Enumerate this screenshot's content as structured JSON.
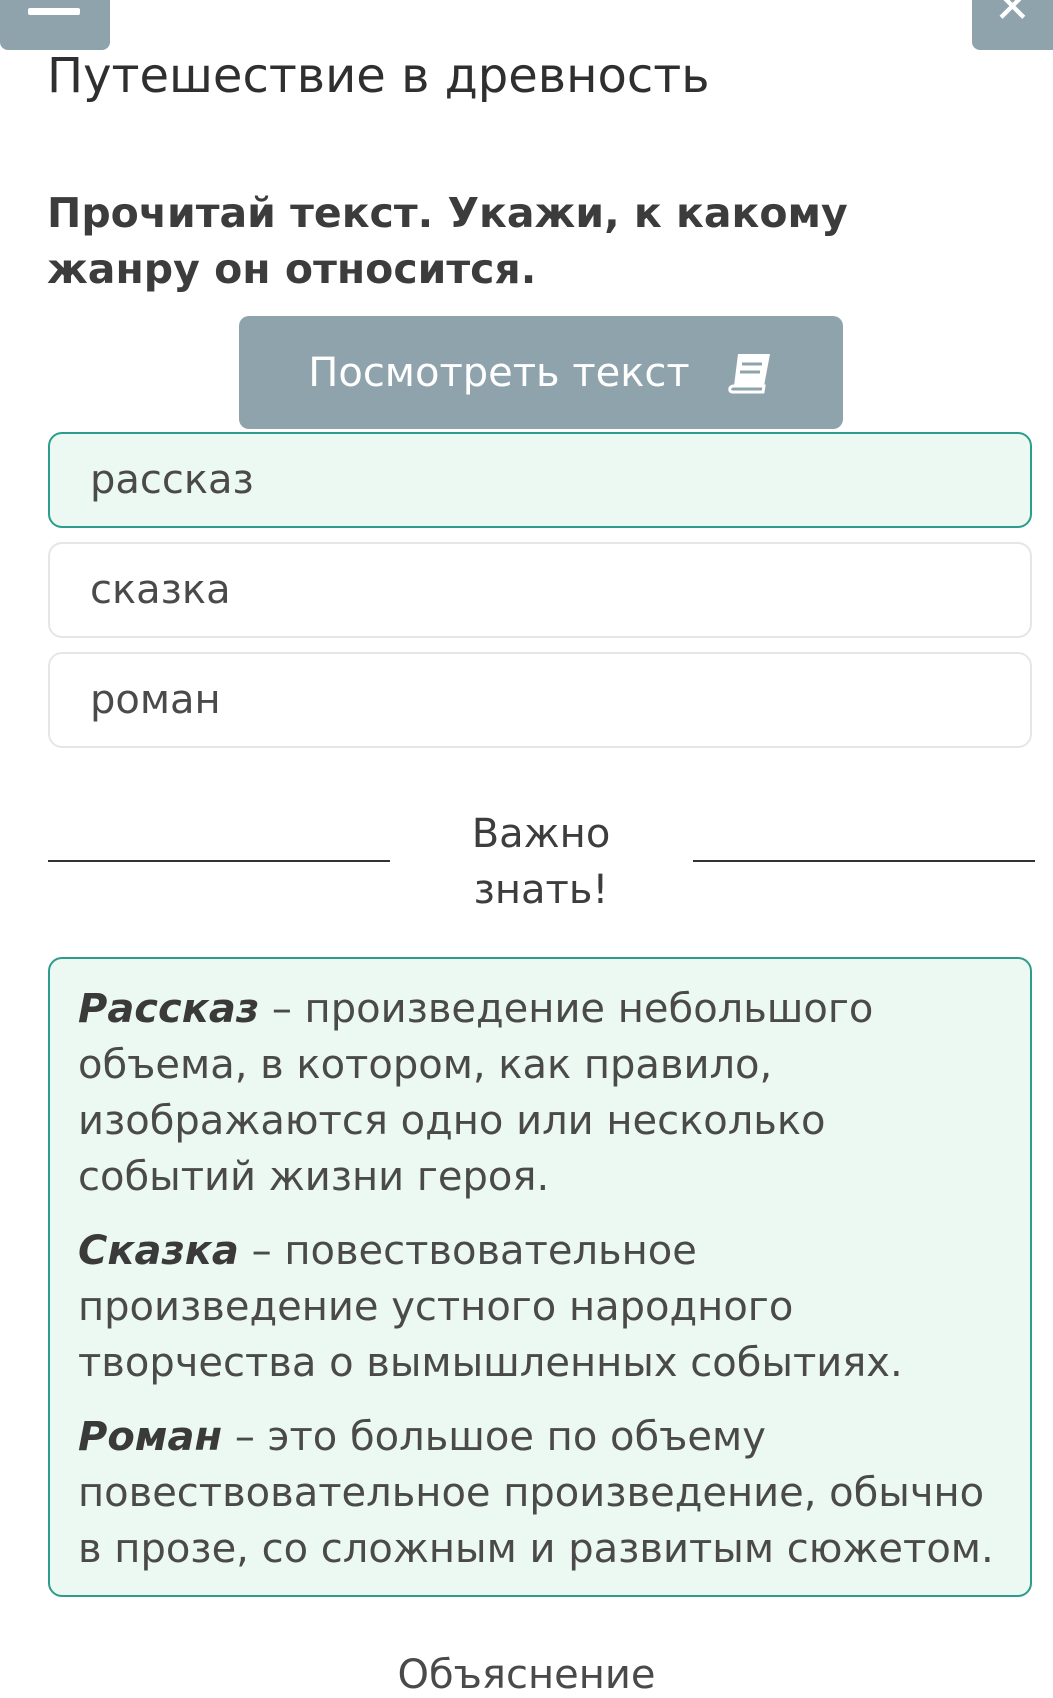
{
  "header": {
    "title": "Путешествие в древность"
  },
  "question": {
    "text": "Прочитай текст. Укажи, к какому жанру он относится."
  },
  "view_text_button": {
    "label": "Посмотреть текст",
    "icon": "book-icon"
  },
  "options": [
    {
      "label": "рассказ",
      "selected": true
    },
    {
      "label": "сказка",
      "selected": false
    },
    {
      "label": "роман",
      "selected": false
    }
  ],
  "important": {
    "heading": "Важно знать!"
  },
  "definitions": [
    {
      "term": "Рассказ",
      "text": " – произведение небольшого объема, в котором, как правило, изображаются одно или несколько событий жизни героя."
    },
    {
      "term": "Сказка",
      "text": " – повествовательное произведение устного народного творчества о вымышленных событиях."
    },
    {
      "term": "Роман",
      "text": " – это большое по объему повествовательное произведение, обычно в прозе, со сложным и развитым сюжетом."
    }
  ],
  "footer": {
    "explanation_label": "Объяснение"
  },
  "colors": {
    "button_gray": "#8fa3ad",
    "accent_teal": "#2d9c8b",
    "selected_bg": "#ecf8f2"
  }
}
